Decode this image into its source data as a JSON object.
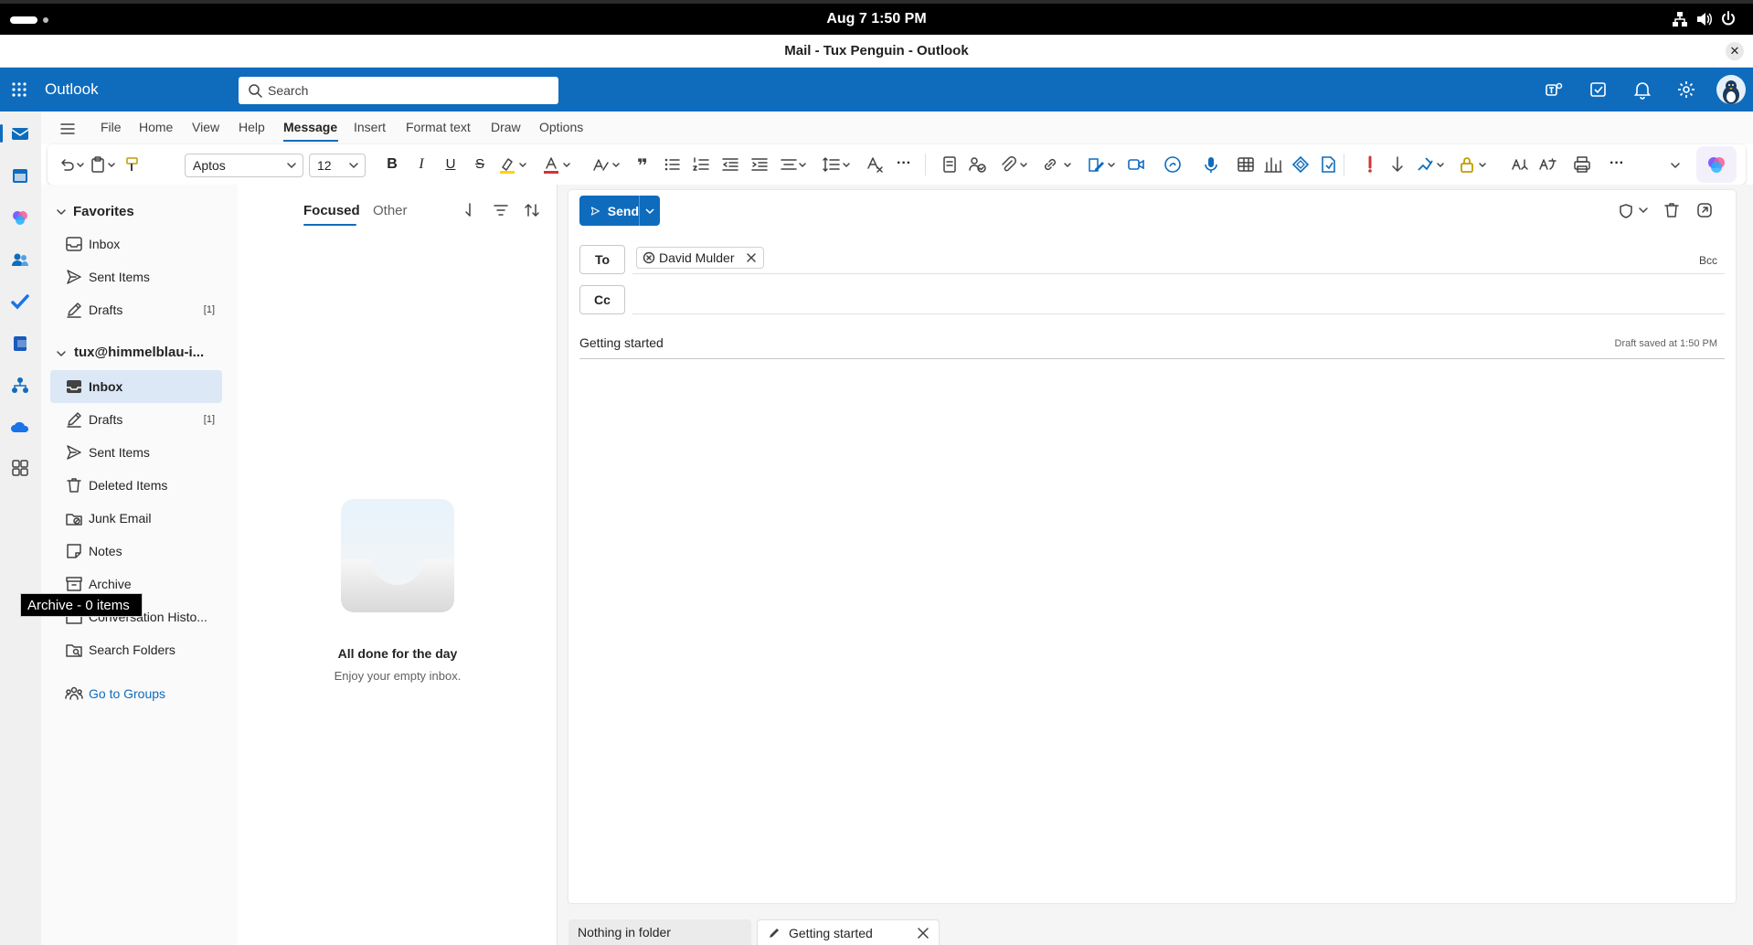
{
  "system": {
    "clock": "Aug 7   1:50 PM"
  },
  "window": {
    "title": "Mail - Tux Penguin - Outlook"
  },
  "header": {
    "app_name": "Outlook",
    "search_placeholder": "Search"
  },
  "ribbon": {
    "tabs": [
      "File",
      "Home",
      "View",
      "Help",
      "Message",
      "Insert",
      "Format text",
      "Draw",
      "Options"
    ],
    "active_tab": "Message",
    "font_family": "Aptos",
    "font_size": "12"
  },
  "folders": {
    "favorites_label": "Favorites",
    "favorites": [
      {
        "label": "Inbox",
        "icon": "inbox-icon"
      },
      {
        "label": "Sent Items",
        "icon": "send-icon"
      },
      {
        "label": "Drafts",
        "icon": "pencil-icon",
        "count": "[1]"
      }
    ],
    "account_label": "tux@himmelblau-i...",
    "items": [
      {
        "label": "Inbox",
        "icon": "inbox-icon",
        "selected": true
      },
      {
        "label": "Drafts",
        "icon": "pencil-icon",
        "count": "[1]"
      },
      {
        "label": "Sent Items",
        "icon": "send-icon"
      },
      {
        "label": "Deleted Items",
        "icon": "trash-icon"
      },
      {
        "label": "Junk Email",
        "icon": "junk-icon"
      },
      {
        "label": "Notes",
        "icon": "note-icon"
      },
      {
        "label": "Archive",
        "icon": "archive-icon"
      },
      {
        "label": "Conversation Histo...",
        "icon": "folder-icon"
      },
      {
        "label": "Search Folders",
        "icon": "search-folder-icon"
      }
    ],
    "groups_label": "Go to Groups",
    "tooltip": "Archive - 0 items"
  },
  "message_list": {
    "tab_focused": "Focused",
    "tab_other": "Other",
    "empty_title": "All done for the day",
    "empty_subtitle": "Enjoy your empty inbox."
  },
  "compose": {
    "send_label": "Send",
    "to_label": "To",
    "cc_label": "Cc",
    "bcc_label": "Bcc",
    "recipient": "David Mulder",
    "subject": "Getting started",
    "draft_status": "Draft saved at 1:50 PM"
  },
  "bottom_tabs": {
    "tab1": "Nothing in folder",
    "tab2": "Getting started"
  },
  "colors": {
    "brand": "#0f6cbd",
    "selected": "#dce8f6"
  }
}
